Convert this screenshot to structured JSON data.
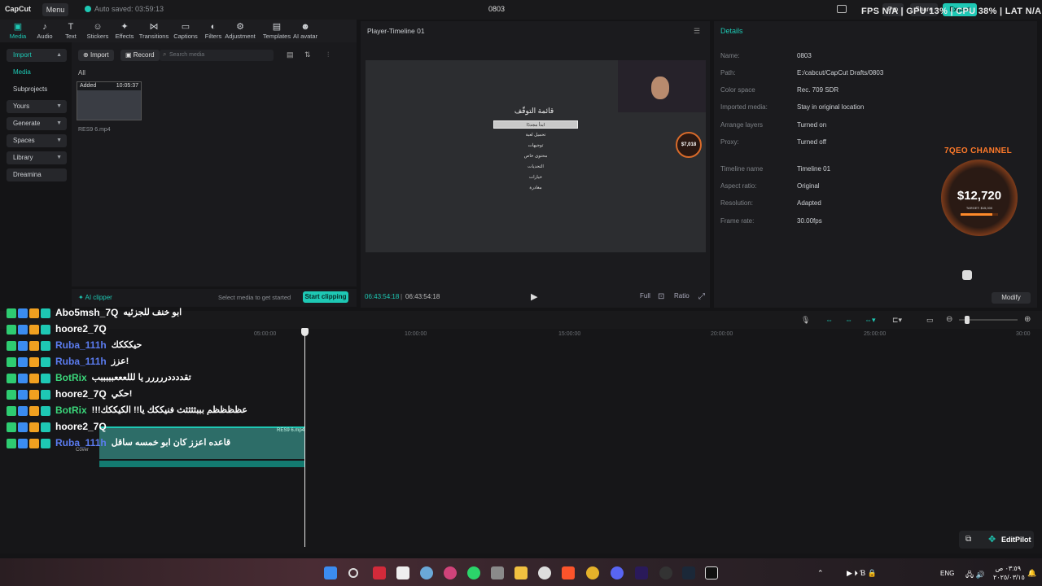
{
  "app": {
    "logo": "CapCut",
    "menu_label": "Menu",
    "autosave": "Auto saved: 03:59:13",
    "project_name": "0803",
    "pro_label": "Pro",
    "share_label": "Share",
    "export_label": "Export",
    "overlay_stats": "FPS N/A | GPU 13% | CPU 38% | LAT N/A"
  },
  "categories": [
    {
      "label": "Media",
      "icon": "media-icon"
    },
    {
      "label": "Audio",
      "icon": "audio-icon"
    },
    {
      "label": "Text",
      "icon": "text-icon"
    },
    {
      "label": "Stickers",
      "icon": "stickers-icon"
    },
    {
      "label": "Effects",
      "icon": "effects-icon"
    },
    {
      "label": "Transitions",
      "icon": "transitions-icon"
    },
    {
      "label": "Captions",
      "icon": "captions-icon"
    },
    {
      "label": "Filters",
      "icon": "filters-icon"
    },
    {
      "label": "Adjustment",
      "icon": "adjustment-icon"
    },
    {
      "label": "Templates",
      "icon": "templates-icon"
    },
    {
      "label": "AI avatar",
      "icon": "ai-avatar-icon"
    }
  ],
  "sidenav": [
    "Import",
    "Media",
    "Subprojects",
    "Yours",
    "Generate",
    "Spaces",
    "Library",
    "Dreamina"
  ],
  "media": {
    "import_label": "Import",
    "record_label": "Record",
    "search_placeholder": "Search media",
    "filter_all": "All",
    "thumb_added": "Added",
    "thumb_duration": "10:05:37",
    "thumb_name": "RES9 6.mp4"
  },
  "clipper": {
    "title": "AI clipper",
    "hint": "Select media to get started",
    "button": "Start clipping"
  },
  "player": {
    "title": "Player-Timeline 01",
    "current_time": "06:43:54:18",
    "total_time": "06:43:54:18",
    "pause_menu_title": "قائمة التوقّف",
    "pause_items": [
      "ابدأ مجددًا",
      "تحميل لعبة",
      "توجيهات",
      "محتوى خاص",
      "التحديات",
      "خيارات",
      "مغادرة"
    ],
    "coin_small": "$7,018",
    "ctrl_full": "Full",
    "ctrl_ratio": "Ratio"
  },
  "details": {
    "title": "Details",
    "rows": [
      {
        "label": "Name:",
        "value": "0803"
      },
      {
        "label": "Path:",
        "value": "E:/cabcut/CapCut Drafts/0803"
      },
      {
        "label": "Color space",
        "value": "Rec. 709 SDR"
      },
      {
        "label": "Imported media:",
        "value": "Stay in original location"
      },
      {
        "label": "Arrange layers",
        "value": "Turned on"
      },
      {
        "label": "Proxy:",
        "value": "Turned off"
      },
      {
        "label": "Timeline name",
        "value": "Timeline 01"
      },
      {
        "label": "Aspect ratio:",
        "value": "Original"
      },
      {
        "label": "Resolution:",
        "value": "Adapted"
      },
      {
        "label": "Frame rate:",
        "value": "30.00fps"
      }
    ],
    "modify": "Modify"
  },
  "stream_overlay": {
    "channel": "7QEO CHANNEL",
    "amount": "$12,720",
    "target": "TARGET: $15,000",
    "target_progress": 0.85
  },
  "timeline": {
    "ticks": [
      "05:00:00",
      "10:00:00",
      "15:00:00",
      "20:00:00",
      "25:00:00",
      "30:00"
    ],
    "clip_name": "RES9 6.mp4",
    "cover_label": "Cover"
  },
  "chat": [
    {
      "user": "Abo5msh_7Q",
      "color": "#ffffff",
      "msg": "ابو خنف للجزئيه"
    },
    {
      "user": "hoore2_7Q",
      "color": "#ffffff",
      "msg": ""
    },
    {
      "user": "Ruba_111h",
      "color": "#5b7cf0",
      "msg": "حيكككك"
    },
    {
      "user": "Ruba_111h",
      "color": "#5b7cf0",
      "msg": "عزز!"
    },
    {
      "user": "BotRix",
      "color": "#3ad67a",
      "msg": "تقددددررررر يا لللعععبببببب"
    },
    {
      "user": "hoore2_7Q",
      "color": "#ffffff",
      "msg": "حكي!"
    },
    {
      "user": "BotRix",
      "color": "#3ad67a",
      "msg": "!!!عظظظظم بببثثثثث فنيككك يا!! الكيككك"
    },
    {
      "user": "hoore2_7Q",
      "color": "#ffffff",
      "msg": ""
    },
    {
      "user": "Ruba_111h",
      "color": "#5b7cf0",
      "msg": "قاعده اعزز كان ابو خمسه ساقل"
    }
  ],
  "editpilot": "EditPilot",
  "taskbar": {
    "lang": "ENG",
    "time": "٠٣:٥٩ ص",
    "date": "٢٠٢٥/٠٣/١٥"
  },
  "colors": {
    "accent": "#1ec8b4",
    "bg": "#141416",
    "panel": "#1b1b1e"
  }
}
